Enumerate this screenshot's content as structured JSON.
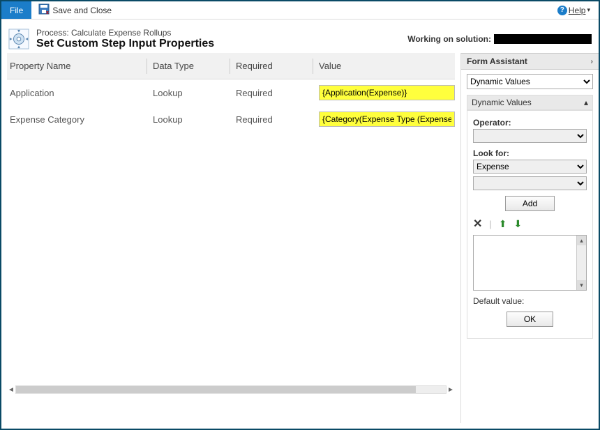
{
  "menubar": {
    "file": "File",
    "save_close": "Save and Close",
    "help": "Help"
  },
  "header": {
    "process_label": "Process: Calculate Expense Rollups",
    "page_title": "Set Custom Step Input Properties",
    "working_on": "Working on solution:"
  },
  "grid": {
    "headers": {
      "name": "Property Name",
      "type": "Data Type",
      "required": "Required",
      "value": "Value"
    },
    "rows": [
      {
        "name": "Application",
        "type": "Lookup",
        "required": "Required",
        "value": "{Application(Expense)}"
      },
      {
        "name": "Expense Category",
        "type": "Lookup",
        "required": "Required",
        "value": "{Category(Expense Type (Expense"
      }
    ]
  },
  "assistant": {
    "title": "Form Assistant",
    "dropdown": "Dynamic Values",
    "section": "Dynamic Values",
    "operator_label": "Operator:",
    "operator_value": "",
    "lookfor_label": "Look for:",
    "lookfor_value": "Expense",
    "lookfor_field": "",
    "add_btn": "Add",
    "default_label": "Default value:",
    "ok_btn": "OK"
  }
}
